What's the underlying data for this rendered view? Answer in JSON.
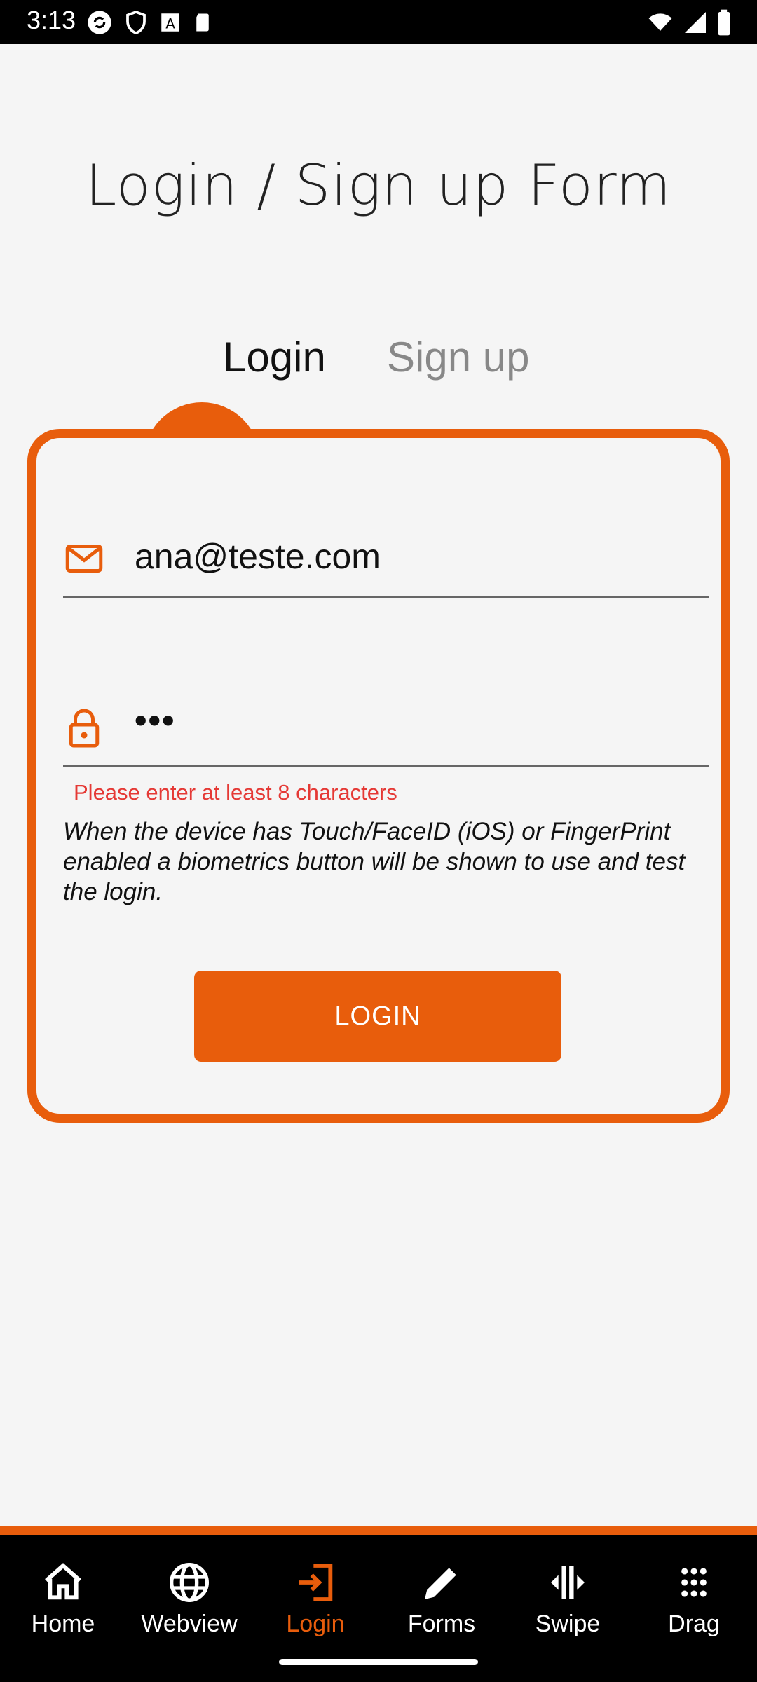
{
  "status_bar": {
    "time": "3:13"
  },
  "page": {
    "title": "Login / Sign up Form"
  },
  "tabs": [
    {
      "label": "Login",
      "active": true
    },
    {
      "label": "Sign up",
      "active": false
    }
  ],
  "form": {
    "email_value": "ana@teste.com",
    "password_value": "•••",
    "error": "Please enter at least 8 characters",
    "info": "When the device has Touch/FaceID (iOS) or FingerPrint enabled a biometrics button will be shown to use and test the login.",
    "button_label": "LOGIN"
  },
  "nav": [
    {
      "label": "Home",
      "icon": "home-icon"
    },
    {
      "label": "Webview",
      "icon": "globe-icon"
    },
    {
      "label": "Login",
      "icon": "login-icon",
      "active": true
    },
    {
      "label": "Forms",
      "icon": "pencil-icon"
    },
    {
      "label": "Swipe",
      "icon": "swipe-icon"
    },
    {
      "label": "Drag",
      "icon": "drag-icon"
    }
  ],
  "colors": {
    "accent": "#e85d0c",
    "error": "#e53935",
    "background": "#f5f5f5"
  }
}
